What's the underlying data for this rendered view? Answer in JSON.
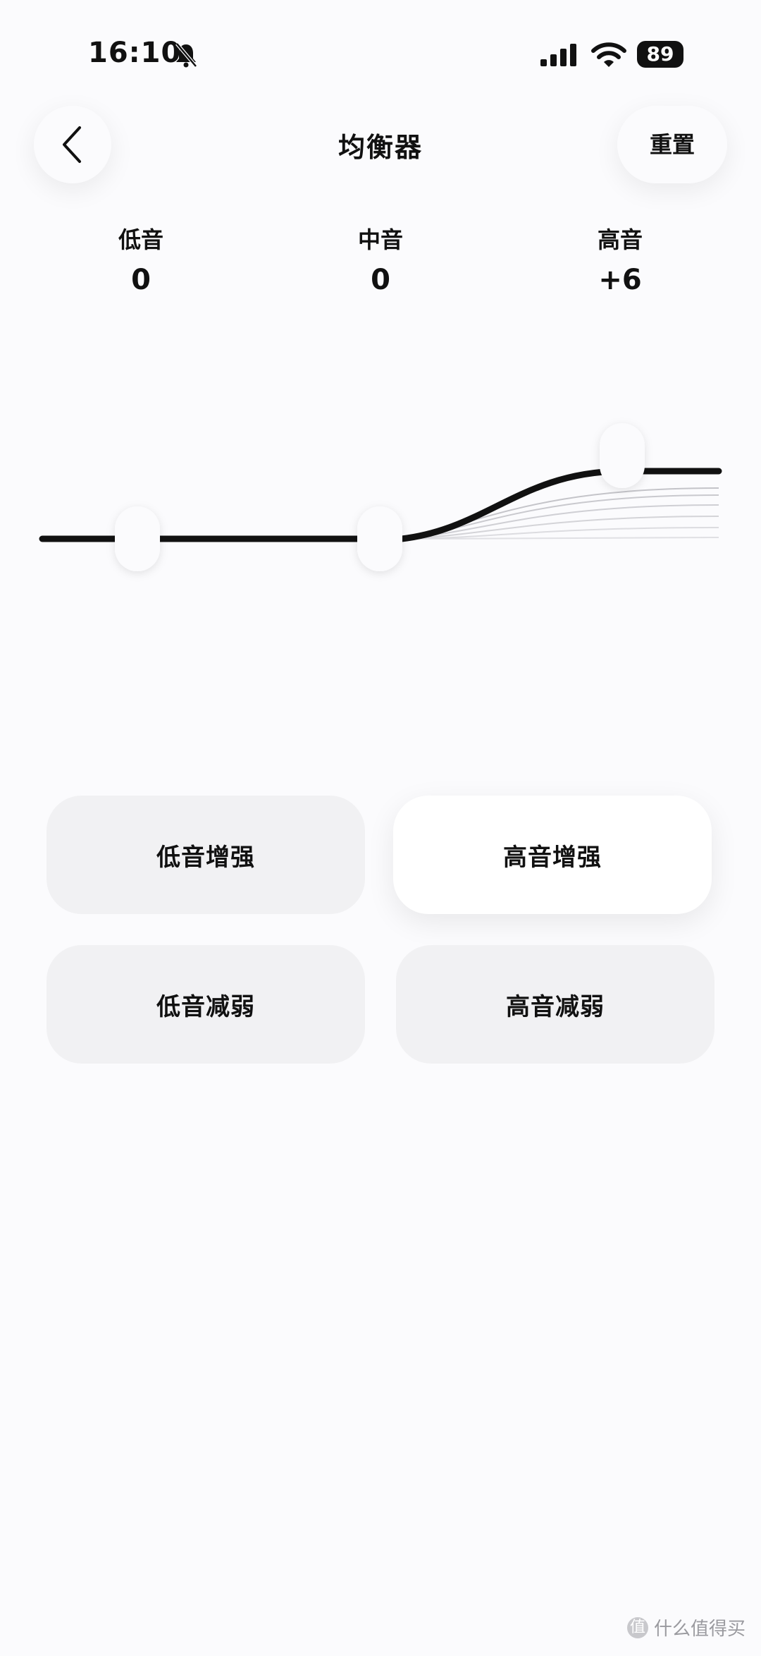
{
  "status_bar": {
    "time": "16:10",
    "battery": "89"
  },
  "header": {
    "title": "均衡器",
    "reset_label": "重置"
  },
  "bands": [
    {
      "label": "低音",
      "value": "0",
      "level": 0
    },
    {
      "label": "中音",
      "value": "0",
      "level": 0
    },
    {
      "label": "高音",
      "value": "+6",
      "level": 6
    }
  ],
  "presets": [
    {
      "label": "低音增强",
      "active": false
    },
    {
      "label": "高音增强",
      "active": true
    },
    {
      "label": "低音减弱",
      "active": false
    },
    {
      "label": "高音减弱",
      "active": false
    }
  ],
  "icons": {
    "back": "chevron-left-icon",
    "bell": "bell-muted-icon",
    "signal": "cellular-signal-icon",
    "wifi": "wifi-icon"
  },
  "watermark": {
    "logo_char": "值",
    "text": "什么值得买"
  }
}
